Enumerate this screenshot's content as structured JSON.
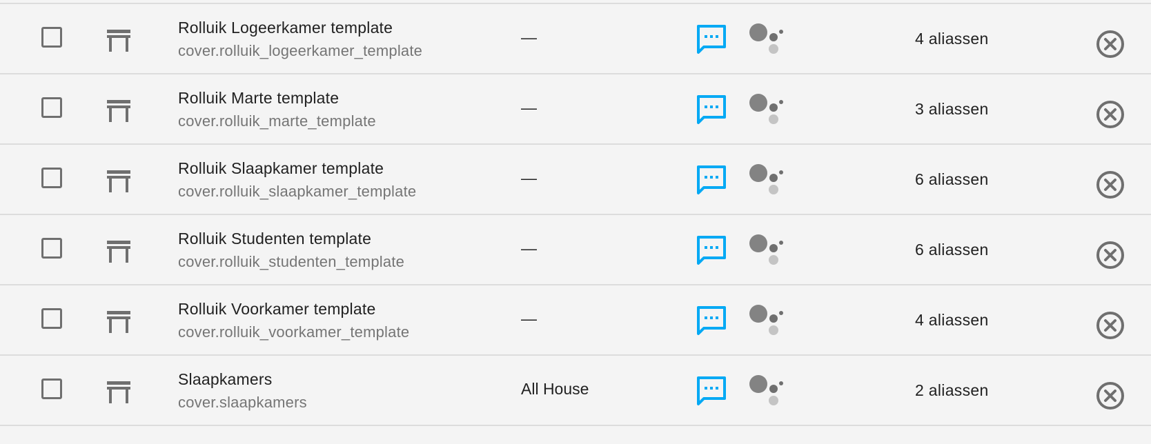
{
  "colors": {
    "background": "#f4f4f4",
    "divider": "#dcdcdc",
    "primary_text": "#212121",
    "secondary_text": "#757575",
    "icon_gray": "#6f6f6f",
    "assist_blue": "#03a9f4"
  },
  "icons": {
    "checkbox": "checkbox-blank-outline",
    "entity": "window-shutter",
    "assist": "message-processing-outline",
    "google_assistant": "google-assistant",
    "remove": "close-circle-outline"
  },
  "rows": [
    {
      "name": "Rolluik Logeerkamer template",
      "entity_id": "cover.rolluik_logeerkamer_template",
      "area": "—",
      "aliases": "4 aliassen"
    },
    {
      "name": "Rolluik Marte template",
      "entity_id": "cover.rolluik_marte_template",
      "area": "—",
      "aliases": "3 aliassen"
    },
    {
      "name": "Rolluik Slaapkamer template",
      "entity_id": "cover.rolluik_slaapkamer_template",
      "area": "—",
      "aliases": "6 aliassen"
    },
    {
      "name": "Rolluik Studenten template",
      "entity_id": "cover.rolluik_studenten_template",
      "area": "—",
      "aliases": "6 aliassen"
    },
    {
      "name": "Rolluik Voorkamer template",
      "entity_id": "cover.rolluik_voorkamer_template",
      "area": "—",
      "aliases": "4 aliassen"
    },
    {
      "name": "Slaapkamers",
      "entity_id": "cover.slaapkamers",
      "area": "All House",
      "aliases": "2 aliassen"
    }
  ]
}
